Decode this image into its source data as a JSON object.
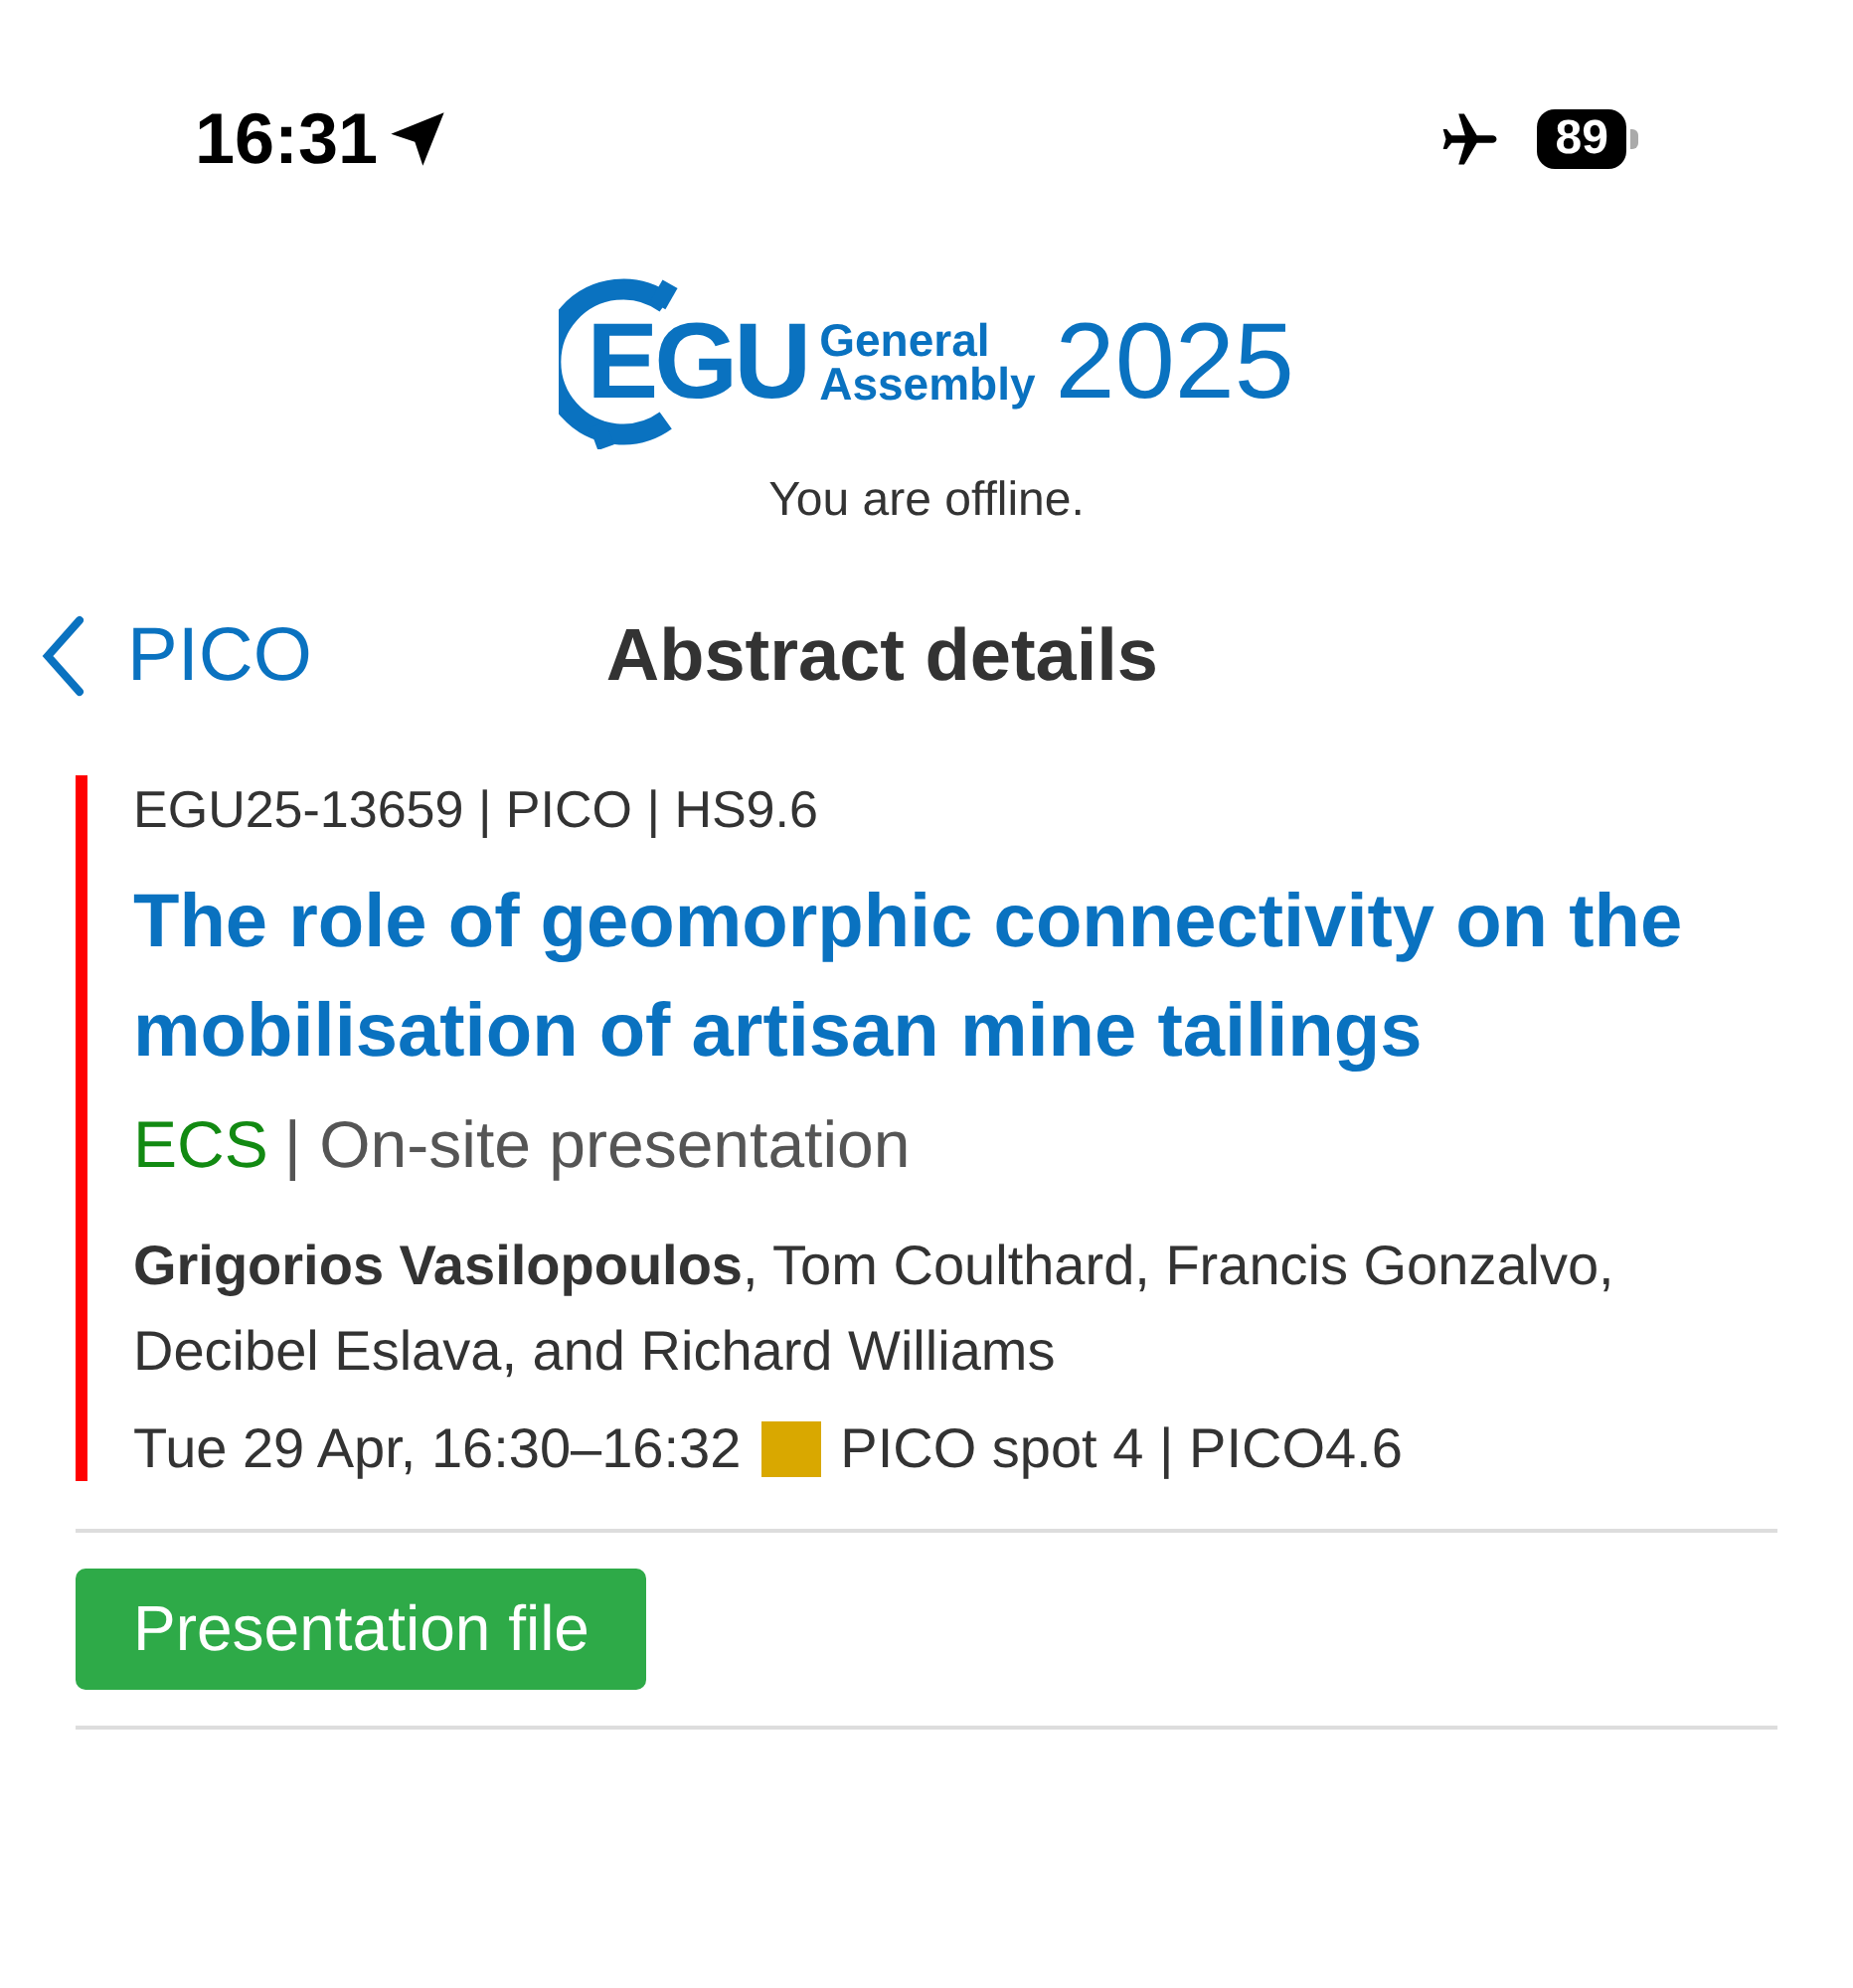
{
  "status_bar": {
    "time": "16:31",
    "battery": "89"
  },
  "logo": {
    "mark": "EGU",
    "line_1": "General",
    "line_2": "Assembly",
    "year": "2025"
  },
  "offline_notice": "You are offline.",
  "nav": {
    "back_label": "PICO",
    "title": "Abstract details"
  },
  "abstract": {
    "id_line": "EGU25-13659 | PICO | HS9.6",
    "title": "The role of geomorphic connectivity on the mobilisation of artisan mine tailings",
    "badge": "ECS",
    "presentation": "| On-site presentation",
    "authors": "**Grigorios Vasilopoulos**, Tom Coulthard, Francis Gonzalvo, Decibel Eslava, and Richard Williams",
    "time": "Tue 29 Apr, 16:30–16:32",
    "color": "#d9a800",
    "location": "PICO spot 4 | PICO4.6"
  },
  "buttons": [
    {
      "label": "Presentation file"
    }
  ]
}
